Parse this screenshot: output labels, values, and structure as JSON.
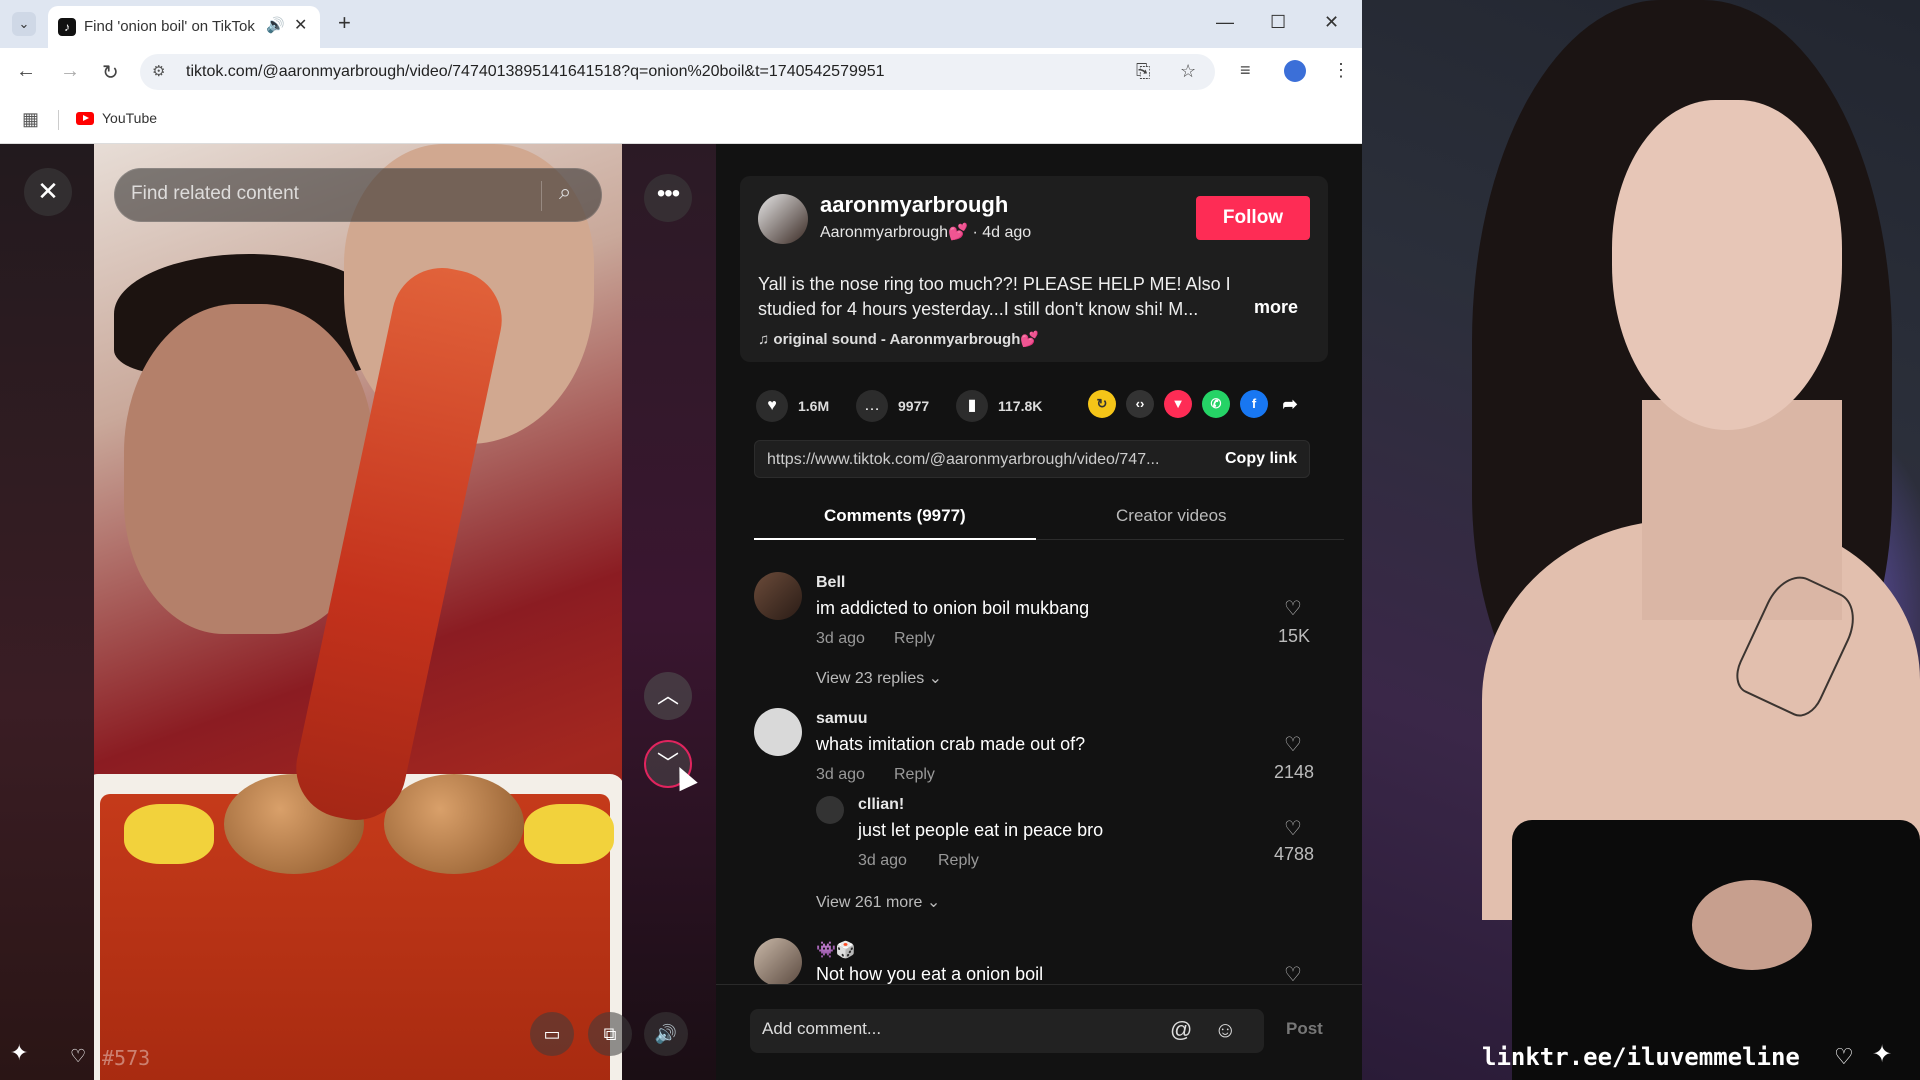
{
  "browser": {
    "tab": {
      "title": "Find 'onion boil' on TikTok"
    },
    "url": "tiktok.com/@aaronmyarbrough/video/7474013895141641518?q=onion%20boil&t=1740542579951",
    "bookmarks": [
      {
        "label": "YouTube"
      }
    ]
  },
  "video": {
    "search_placeholder": "Find related content",
    "overlay_number": "#573"
  },
  "post": {
    "username": "aaronmyarbrough",
    "display_name": "Aaronmyarbrough💕",
    "age": "· 4d ago",
    "follow_label": "Follow",
    "caption_line1": "Yall is the nose ring too much??! PLEASE HELP ME! Also I",
    "caption_line2": "studied for 4 hours yesterday...I still don't know shi! M...",
    "more_label": "more",
    "sound": "original sound - Aaronmyarbrough💕",
    "stats": {
      "likes": "1.6M",
      "comments": "9977",
      "saves": "117.8K"
    },
    "share_link": "https://www.tiktok.com/@aaronmyarbrough/video/747...",
    "copy_link_label": "Copy link"
  },
  "tabs": {
    "comments": "Comments (9977)",
    "creator": "Creator videos"
  },
  "comments": [
    {
      "user": "Bell",
      "text": "im addicted to onion boil mukbang",
      "date": "3d ago",
      "reply": "Reply",
      "likes": "15K",
      "view_more": "View 23 replies ⌄"
    },
    {
      "user": "samuu",
      "text": "whats imitation crab made out of?",
      "date": "3d ago",
      "reply": "Reply",
      "likes": "2148",
      "view_more": "View 261 more ⌄",
      "sub_reply": {
        "user": "cllian!",
        "text": "just let people eat in peace bro",
        "date": "3d ago",
        "reply": "Reply",
        "likes": "4788"
      }
    },
    {
      "user": "👾🎲",
      "text": "Not how you eat a onion boil"
    }
  ],
  "add_comment": {
    "placeholder": "Add comment...",
    "post_label": "Post"
  },
  "overlay": {
    "link_text": "linktr.ee/iluvemmeline"
  },
  "colors": {
    "follow": "#fe2c55",
    "background": "#121212"
  },
  "icons": [
    "search-icon",
    "heart-icon",
    "comment-icon",
    "bookmark-icon",
    "share-icon",
    "close-icon",
    "more-icon",
    "chevron-up-icon",
    "chevron-down-icon",
    "volume-icon",
    "captions-icon",
    "mention-icon",
    "emoji-icon"
  ]
}
